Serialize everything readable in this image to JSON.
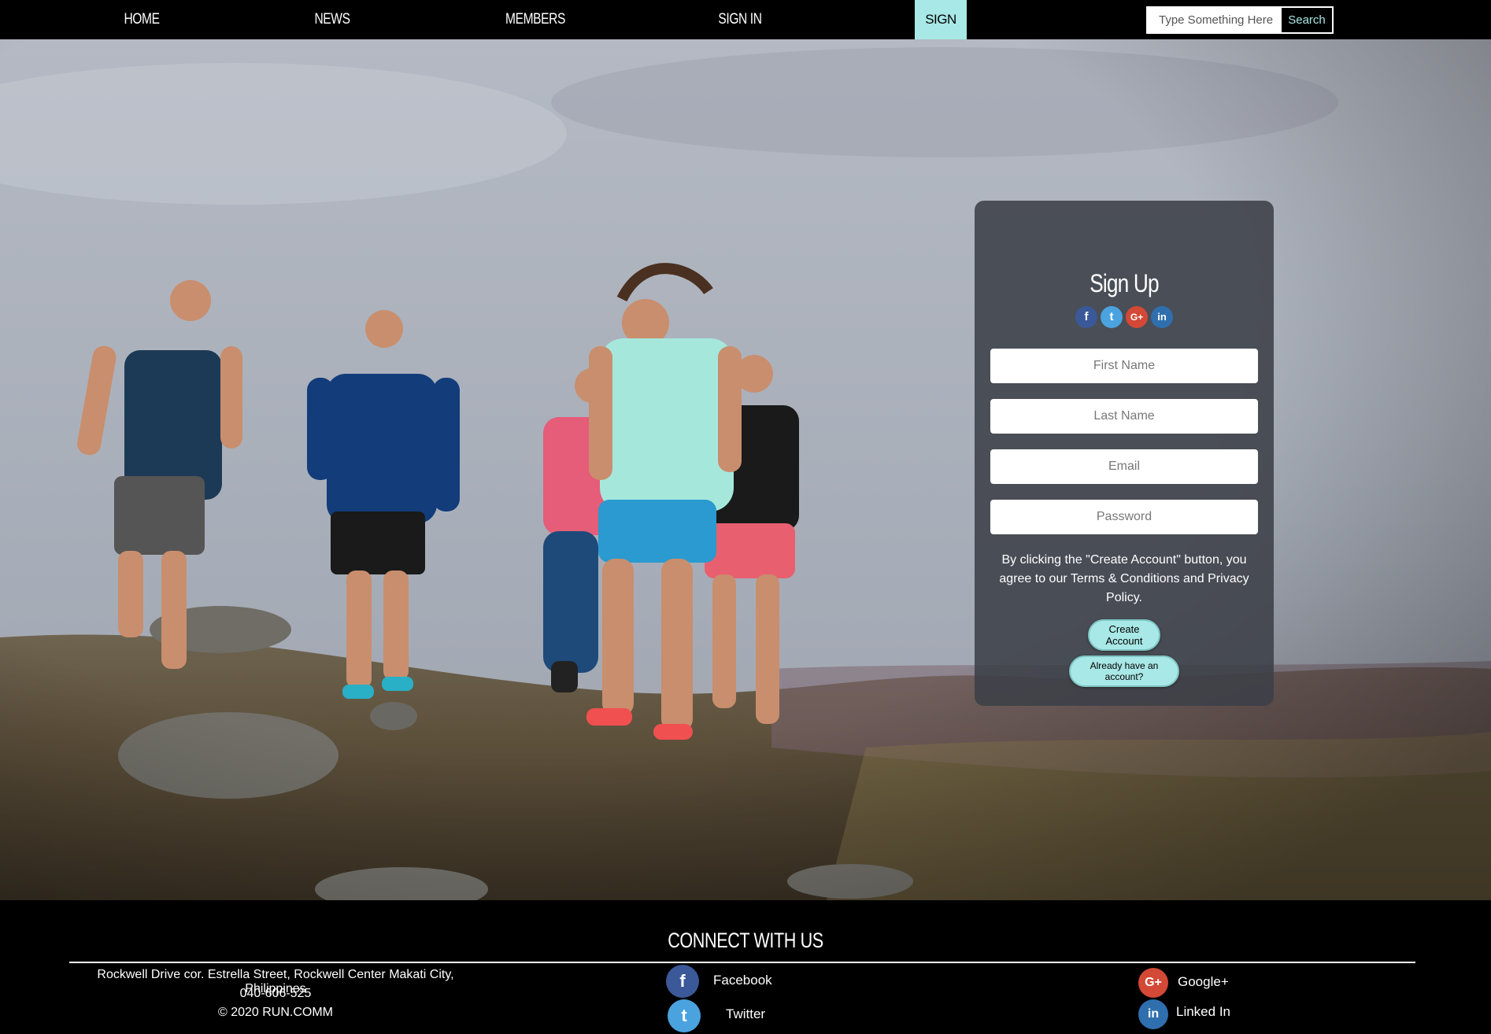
{
  "nav": {
    "items": [
      {
        "label": "HOME"
      },
      {
        "label": "NEWS"
      },
      {
        "label": "MEMBERS"
      },
      {
        "label": "SIGN IN"
      },
      {
        "label": "SIGN UP",
        "active": true
      }
    ],
    "search": {
      "placeholder": "Type Something Here",
      "button_label": "Search"
    }
  },
  "signup": {
    "title": "Sign Up",
    "social": [
      "facebook-icon",
      "twitter-icon",
      "google-plus-icon",
      "linkedin-icon"
    ],
    "fields": {
      "first_name": {
        "placeholder": "First Name"
      },
      "last_name": {
        "placeholder": "Last Name"
      },
      "email": {
        "placeholder": "Email"
      },
      "password": {
        "placeholder": "Password"
      }
    },
    "terms": "By clicking the \"Create Account\" button, you agree to our Terms & Conditions and Privacy Policy.",
    "create_label": "Create Account",
    "signin_label": "Already have an account?"
  },
  "footer": {
    "title": "CONNECT WITH US",
    "address": "Rockwell Drive cor. Estrella Street, Rockwell Center Makati City, Philippines",
    "phone": "040-606-525",
    "copyright": "© 2020 RUN.COMM",
    "links": {
      "facebook": "Facebook",
      "twitter": "Twitter",
      "google": "Google+",
      "linkedin": "Linked In"
    }
  },
  "colors": {
    "accent": "#a8e8e6",
    "background": "#000000"
  }
}
